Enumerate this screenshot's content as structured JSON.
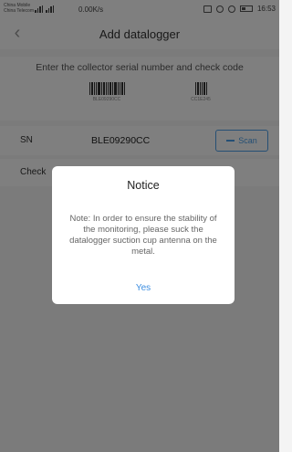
{
  "status_bar": {
    "carrier_line1": "China Mobile",
    "carrier_line2": "China Telecom",
    "speed": "0.00K/s",
    "time": "16:53"
  },
  "header": {
    "title": "Add datalogger",
    "back_icon": "back-arrow-icon"
  },
  "instruction": {
    "text": "Enter the collector serial number and check code",
    "sample_sn_number": "BLE09290CC",
    "sample_check_number": "CC1E245"
  },
  "form": {
    "sn_label": "SN",
    "sn_value": "BLE09290CC",
    "scan_label": "Scan",
    "check_label": "Check"
  },
  "dialog": {
    "title": "Notice",
    "body": "Note: In order to ensure the stability of the monitoring, please suck the datalogger suction cup antenna on the metal.",
    "button": "Yes"
  },
  "colors": {
    "accent": "#4a9fe8",
    "overlay": "rgba(0,0,0,0.5)"
  }
}
